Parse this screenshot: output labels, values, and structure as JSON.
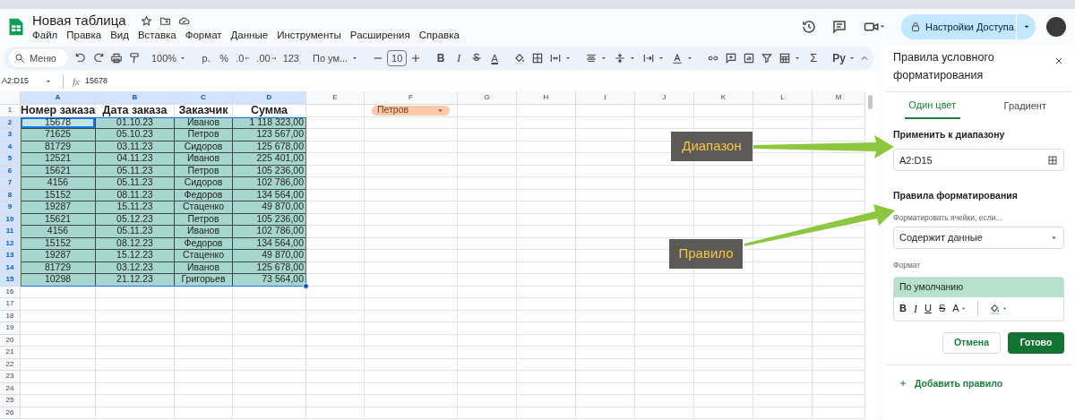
{
  "app": {
    "title": "Новая таблица",
    "menus": [
      "Файл",
      "Правка",
      "Вид",
      "Вставка",
      "Формат",
      "Данные",
      "Инструменты",
      "Расширения",
      "Справка"
    ],
    "share_button": "Настройки Доступа"
  },
  "toolbar": {
    "search": "Меню",
    "zoom": "100%",
    "currency": "р.",
    "percent": "%",
    "decimal_decrease": ".0",
    "decimal_increase": ".00",
    "number_format": "123",
    "font": "По ум...",
    "font_size": "10",
    "bold": "B",
    "italic": "I",
    "text_color": "A",
    "sum": "Σ",
    "input_tools": "Ру"
  },
  "formula_bar": {
    "name_box": "A2:D15",
    "fx": "fx",
    "formula": "15678"
  },
  "sheet": {
    "columns": [
      {
        "label": "A",
        "selected": true
      },
      {
        "label": "B",
        "selected": true
      },
      {
        "label": "C",
        "selected": true
      },
      {
        "label": "D",
        "selected": true
      },
      {
        "label": "E",
        "selected": false
      },
      {
        "label": "F",
        "selected": false
      },
      {
        "label": "G",
        "selected": false
      },
      {
        "label": "H",
        "selected": false
      },
      {
        "label": "I",
        "selected": false
      },
      {
        "label": "J",
        "selected": false
      },
      {
        "label": "K",
        "selected": false
      },
      {
        "label": "L",
        "selected": false
      },
      {
        "label": "M",
        "selected": false
      }
    ],
    "dropdown_chip": {
      "label": "Петров"
    },
    "rows": [
      {
        "number": "1",
        "selected": false,
        "kind": "header",
        "cells": [
          {
            "text": "Номер заказа",
            "active": false
          },
          {
            "text": "Дата заказа",
            "active": false
          },
          {
            "text": "Заказчик",
            "active": false
          },
          {
            "text": "Сумма",
            "active": false
          }
        ]
      },
      {
        "number": "2",
        "selected": true,
        "kind": "data",
        "cells": [
          {
            "text": "15678",
            "active": true
          },
          {
            "text": "01.10.23",
            "active": false
          },
          {
            "text": "Иванов",
            "active": false
          },
          {
            "text": "1 118 323,00",
            "active": false
          }
        ]
      },
      {
        "number": "3",
        "selected": true,
        "kind": "data",
        "cells": [
          {
            "text": "71625",
            "active": false
          },
          {
            "text": "05.10.23",
            "active": false
          },
          {
            "text": "Петров",
            "active": false
          },
          {
            "text": "123 567,00",
            "active": false
          }
        ]
      },
      {
        "number": "4",
        "selected": true,
        "kind": "data",
        "cells": [
          {
            "text": "81729",
            "active": false
          },
          {
            "text": "03.11.23",
            "active": false
          },
          {
            "text": "Сидоров",
            "active": false
          },
          {
            "text": "125 678,00",
            "active": false
          }
        ]
      },
      {
        "number": "5",
        "selected": true,
        "kind": "data",
        "cells": [
          {
            "text": "12521",
            "active": false
          },
          {
            "text": "04.11.23",
            "active": false
          },
          {
            "text": "Иванов",
            "active": false
          },
          {
            "text": "225 401,00",
            "active": false
          }
        ]
      },
      {
        "number": "6",
        "selected": true,
        "kind": "data",
        "cells": [
          {
            "text": "15621",
            "active": false
          },
          {
            "text": "05.11.23",
            "active": false
          },
          {
            "text": "Петров",
            "active": false
          },
          {
            "text": "105 236,00",
            "active": false
          }
        ]
      },
      {
        "number": "7",
        "selected": true,
        "kind": "data",
        "cells": [
          {
            "text": "4156",
            "active": false
          },
          {
            "text": "05.11.23",
            "active": false
          },
          {
            "text": "Сидоров",
            "active": false
          },
          {
            "text": "102 786,00",
            "active": false
          }
        ]
      },
      {
        "number": "8",
        "selected": true,
        "kind": "data",
        "cells": [
          {
            "text": "15152",
            "active": false
          },
          {
            "text": "08.11.23",
            "active": false
          },
          {
            "text": "Федоров",
            "active": false
          },
          {
            "text": "134 564,00",
            "active": false
          }
        ]
      },
      {
        "number": "9",
        "selected": true,
        "kind": "data",
        "cells": [
          {
            "text": "19287",
            "active": false
          },
          {
            "text": "15.11.23",
            "active": false
          },
          {
            "text": "Стаценко",
            "active": false
          },
          {
            "text": "49 870,00",
            "active": false
          }
        ]
      },
      {
        "number": "10",
        "selected": true,
        "kind": "data",
        "cells": [
          {
            "text": "15621",
            "active": false
          },
          {
            "text": "05.12.23",
            "active": false
          },
          {
            "text": "Петров",
            "active": false
          },
          {
            "text": "105 236,00",
            "active": false
          }
        ]
      },
      {
        "number": "11",
        "selected": true,
        "kind": "data",
        "cells": [
          {
            "text": "4156",
            "active": false
          },
          {
            "text": "05.11.23",
            "active": false
          },
          {
            "text": "Иванов",
            "active": false
          },
          {
            "text": "102 786,00",
            "active": false
          }
        ]
      },
      {
        "number": "12",
        "selected": true,
        "kind": "data",
        "cells": [
          {
            "text": "15152",
            "active": false
          },
          {
            "text": "08.12.23",
            "active": false
          },
          {
            "text": "Федоров",
            "active": false
          },
          {
            "text": "134 564,00",
            "active": false
          }
        ]
      },
      {
        "number": "13",
        "selected": true,
        "kind": "data",
        "cells": [
          {
            "text": "19287",
            "active": false
          },
          {
            "text": "15.12.23",
            "active": false
          },
          {
            "text": "Стаценко",
            "active": false
          },
          {
            "text": "49 870,00",
            "active": false
          }
        ]
      },
      {
        "number": "14",
        "selected": true,
        "kind": "data",
        "cells": [
          {
            "text": "81729",
            "active": false
          },
          {
            "text": "03.12.23",
            "active": false
          },
          {
            "text": "Иванов",
            "active": false
          },
          {
            "text": "125 678,00",
            "active": false
          }
        ]
      },
      {
        "number": "15",
        "selected": true,
        "kind": "data",
        "cells": [
          {
            "text": "10298",
            "active": false
          },
          {
            "text": "21.12.23",
            "active": false
          },
          {
            "text": "Григорьев",
            "active": false
          },
          {
            "text": "73 564,00",
            "active": false
          }
        ]
      },
      {
        "number": "16",
        "selected": false,
        "kind": "empty"
      },
      {
        "number": "17",
        "selected": false,
        "kind": "empty"
      },
      {
        "number": "18",
        "selected": false,
        "kind": "empty"
      },
      {
        "number": "19",
        "selected": false,
        "kind": "empty"
      },
      {
        "number": "20",
        "selected": false,
        "kind": "empty"
      },
      {
        "number": "21",
        "selected": false,
        "kind": "empty"
      },
      {
        "number": "22",
        "selected": false,
        "kind": "empty"
      },
      {
        "number": "23",
        "selected": false,
        "kind": "empty"
      },
      {
        "number": "24",
        "selected": false,
        "kind": "empty"
      },
      {
        "number": "25",
        "selected": false,
        "kind": "empty"
      },
      {
        "number": "26",
        "selected": false,
        "kind": "empty"
      }
    ]
  },
  "panel": {
    "title": "Правила условного форматирования",
    "tabs": [
      {
        "label": "Один цвет",
        "selected": true
      },
      {
        "label": "Градиент",
        "selected": false
      }
    ],
    "range_label": "Применить к диапазону",
    "range": "A2:D15",
    "rules_heading": "Правила форматирования",
    "condition_label": "Форматировать ячейки, если...",
    "condition": "Содержит данные",
    "format_label": "Формат",
    "format_preview": "По умолчанию",
    "format_tools": {
      "bold": "B",
      "italic": "I",
      "underline": "U",
      "strike": "S",
      "text_color": "A"
    },
    "cancel_button": "Отмена",
    "done_button": "Готово",
    "add_rule": "Добавить правило"
  },
  "annotations": [
    {
      "label": "Диапазон"
    },
    {
      "label": "Правило"
    }
  ]
}
